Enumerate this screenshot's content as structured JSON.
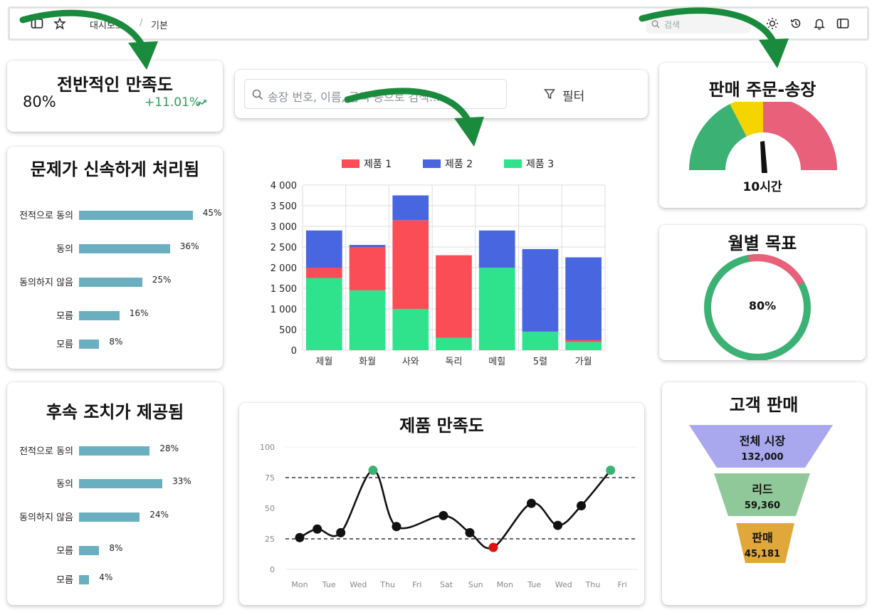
{
  "topbar": {
    "breadcrumb_parent": "대시보드",
    "breadcrumb_sep": "/",
    "breadcrumb_current": "기본",
    "search_placeholder": "검색",
    "icons": [
      "sidebar-icon",
      "star-icon",
      "sun-icon",
      "history-icon",
      "bell-icon",
      "panel-icon"
    ]
  },
  "satisfaction": {
    "title": "전반적인 만족도",
    "value": "80%",
    "change": "+11.01%",
    "change_color": "#2e9e5b"
  },
  "search_bar": {
    "placeholder": "송장 번호, 이름, 금액 등으로 검색...",
    "filter_label": "필터"
  },
  "resolved": {
    "title": "문제가 신속하게 처리됨",
    "rows": [
      {
        "label": "전적으로 동의",
        "pct": 45,
        "text": "45%"
      },
      {
        "label": "동의",
        "pct": 36,
        "text": "36%"
      },
      {
        "label": "동의하지 않음",
        "pct": 25,
        "text": "25%"
      },
      {
        "label": "모름",
        "pct": 16,
        "text": "16%"
      },
      {
        "label": "모름",
        "pct": 8,
        "text": "8%"
      }
    ]
  },
  "followup": {
    "title": "후속 조치가 제공됨",
    "rows": [
      {
        "label": "전적으로 동의",
        "pct": 28,
        "text": "28%"
      },
      {
        "label": "동의",
        "pct": 33,
        "text": "33%"
      },
      {
        "label": "동의하지 않음",
        "pct": 24,
        "text": "24%"
      },
      {
        "label": "모름",
        "pct": 8,
        "text": "8%"
      },
      {
        "label": "모름",
        "pct": 4,
        "text": "4%"
      }
    ]
  },
  "orders": {
    "title": "판매 주문-송장",
    "value_label": "10시간",
    "colors": {
      "green": "#3bb273",
      "yellow": "#f5d400",
      "red": "#e8607a"
    }
  },
  "monthly_goal": {
    "title": "월별 목표",
    "value": 80,
    "value_label": "80%",
    "colors": {
      "done": "#3bb273",
      "rest": "#e8607a"
    }
  },
  "funnel": {
    "title": "고객 판매",
    "stages": [
      {
        "name": "전체 시장",
        "value": "132,000",
        "color": "#a9a8ee"
      },
      {
        "name": "리드",
        "value": "59,360",
        "color": "#8fc99a"
      },
      {
        "name": "판매",
        "value": "45,181",
        "color": "#e0a83a"
      }
    ]
  },
  "chart_data": [
    {
      "type": "bar",
      "stacked": true,
      "categories": [
        "제월",
        "화월",
        "사와",
        "독리",
        "메힐",
        "5렬",
        "가월"
      ],
      "series": [
        {
          "name": "제품 1",
          "color": "#fa4d56",
          "values": [
            250,
            1050,
            2150,
            2000,
            0,
            0,
            50
          ]
        },
        {
          "name": "제품 2",
          "color": "#4866e0",
          "values": [
            900,
            50,
            600,
            0,
            900,
            2000,
            2000
          ]
        },
        {
          "name": "제품 3",
          "color": "#2fe38c",
          "values": [
            1750,
            1450,
            1000,
            300,
            2000,
            450,
            200
          ]
        }
      ],
      "ylim": [
        0,
        4000
      ],
      "yticks": [
        "0",
        "500",
        "1 000",
        "1 500",
        "2 000",
        "2 500",
        "3 000",
        "3 500",
        "4 000"
      ],
      "grid": true,
      "legend": "top"
    },
    {
      "type": "line",
      "title": "제품 만족도",
      "x": [
        "Mon",
        "Tue",
        "Wed",
        "Thu",
        "Fri",
        "Sat",
        "Sun",
        "Mon",
        "Tue",
        "Wed",
        "Thu",
        "Fri"
      ],
      "yticks": [
        "0",
        "25",
        "50",
        "75",
        "100"
      ],
      "ylim": [
        0,
        100
      ],
      "points": [
        {
          "x": 0,
          "y": 26,
          "color": "#111111"
        },
        {
          "x": 0.6,
          "y": 33,
          "color": "#111111"
        },
        {
          "x": 1.4,
          "y": 30,
          "color": "#111111"
        },
        {
          "x": 2.5,
          "y": 81,
          "color": "#3bb273"
        },
        {
          "x": 3.3,
          "y": 35,
          "color": "#111111"
        },
        {
          "x": 4.9,
          "y": 44,
          "color": "#111111"
        },
        {
          "x": 5.8,
          "y": 30,
          "color": "#111111"
        },
        {
          "x": 6.6,
          "y": 18,
          "color": "#e01010"
        },
        {
          "x": 7.9,
          "y": 54,
          "color": "#111111"
        },
        {
          "x": 8.8,
          "y": 36,
          "color": "#111111"
        },
        {
          "x": 9.6,
          "y": 52,
          "color": "#111111"
        },
        {
          "x": 10.6,
          "y": 81,
          "color": "#3bb273"
        }
      ],
      "reference_lines": [
        75,
        25
      ]
    }
  ]
}
